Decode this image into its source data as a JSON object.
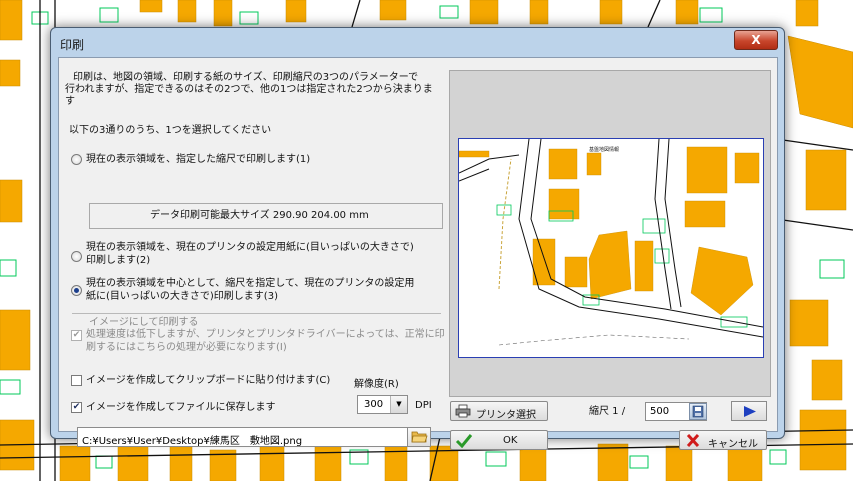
{
  "dialog": {
    "title": "印刷",
    "close_label": "X",
    "description": [
      "印刷は、地図の領域、印刷する紙のサイズ、印刷縮尺の3つのパラメーターで",
      "行われますが、指定できるのはその2つで、他の1つは指定された2つから決まりま",
      "す"
    ],
    "choose_prompt": "以下の3通りのうち、1つを選択してください",
    "options": [
      {
        "lines": [
          "現在の表示領域を、指定した縮尺で印刷します(1)"
        ],
        "selected": false
      },
      {
        "lines": [
          "現在の表示領域を、現在のプリンタの設定用紙に(目いっぱいの大きさで)",
          "印刷します(2)"
        ],
        "selected": false
      },
      {
        "lines": [
          "現在の表示領域を中心として、縮尺を指定して、現在のプリンタの設定用",
          "紙に(目いっぱいの大きさで)印刷します(3)"
        ],
        "selected": true
      }
    ],
    "max_size_text": "データ印刷可能最大サイズ  290.90   204.00  mm",
    "image_print": {
      "title": "イメージにして印刷する",
      "lines": [
        "処理速度は低下しますが、プリンタとプリンタドライバーによっては、正常に印",
        "刷するにはこちらの処理が必要になります(I)"
      ],
      "checked": true
    },
    "clipboard_label": "イメージを作成してクリップボードに貼り付けます(C)",
    "clipboard_checked": false,
    "save_file_label": "イメージを作成してファイルに保存します",
    "save_file_checked": true,
    "resolution_label": "解像度(R)",
    "resolution_value": "300",
    "dpi_label": "DPI",
    "file_path": "C:¥Users¥User¥Desktop¥練馬区　敷地図.png",
    "printer_button": "プリンタ選択",
    "scale_label": "縮尺 1 /",
    "scale_value": "500",
    "ok_button": "OK",
    "cancel_button": "キャンセル",
    "preview_header": "基盤地図情報"
  },
  "colors": {
    "building": "#f5a800",
    "title_bar": "#bcd3ea",
    "preview_border": "#2a3fb3",
    "checkmark": "#2a9a2a",
    "cancel_x": "#d01c1c",
    "next_arrow": "#1d3fc0"
  }
}
